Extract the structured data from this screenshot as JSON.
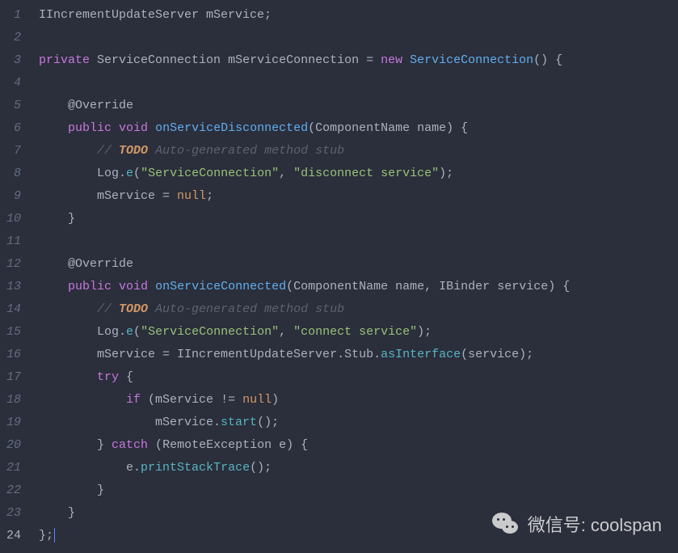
{
  "gutter": {
    "lines": [
      "1",
      "2",
      "3",
      "4",
      "5",
      "6",
      "7",
      "8",
      "9",
      "10",
      "11",
      "12",
      "13",
      "14",
      "15",
      "16",
      "17",
      "18",
      "19",
      "20",
      "21",
      "22",
      "23",
      "24"
    ],
    "active_line": "24"
  },
  "code": {
    "l1": {
      "type1": "IIncrementUpdateServer",
      "var": " mService;"
    },
    "l3": {
      "kw": "private",
      "sp1": " ",
      "type": "ServiceConnection",
      "sp2": " mServiceConnection = ",
      "kw2": "new",
      "sp3": " ",
      "ctor": "ServiceConnection",
      "tail": "() {"
    },
    "l5": {
      "anno": "@Override"
    },
    "l6": {
      "kw": "public",
      "sp": " ",
      "kw2": "void",
      "sp2": " ",
      "method": "onServiceDisconnected",
      "open": "(",
      "ptype": "ComponentName",
      "pname": " name",
      "close": ") {"
    },
    "l7": {
      "c1": "// ",
      "todo": "TODO",
      "c2": " Auto-generated method stub"
    },
    "l8": {
      "obj": "Log.",
      "m": "e",
      "open": "(",
      "s1": "\"ServiceConnection\"",
      "comma": ", ",
      "s2": "\"disconnect service\"",
      "close": ");"
    },
    "l9": {
      "lhs": "mService = ",
      "nul": "null",
      "semi": ";"
    },
    "l10": {
      "brace": "}"
    },
    "l12": {
      "anno": "@Override"
    },
    "l13": {
      "kw": "public",
      "sp": " ",
      "kw2": "void",
      "sp2": " ",
      "method": "onServiceConnected",
      "open": "(",
      "ptype": "ComponentName",
      "pname": " name, ",
      "ptype2": "IBinder",
      "pname2": " service",
      "close": ") {"
    },
    "l14": {
      "c1": "// ",
      "todo": "TODO",
      "c2": " Auto-generated method stub"
    },
    "l15": {
      "obj": "Log.",
      "m": "e",
      "open": "(",
      "s1": "\"ServiceConnection\"",
      "comma": ", ",
      "s2": "\"connect service\"",
      "close": ");"
    },
    "l16": {
      "txt": "mService = IIncrementUpdateServer.Stub.",
      "m": "asInterface",
      "tail": "(service);"
    },
    "l17": {
      "kw": "try",
      "brace": " {"
    },
    "l18": {
      "kw": "if",
      "open": " (mService != ",
      "nul": "null",
      "close": ")"
    },
    "l19": {
      "txt": "mService.",
      "m": "start",
      "tail": "();"
    },
    "l20": {
      "close": "} ",
      "kw": "catch",
      "open": " (",
      "type": "RemoteException",
      "var": " e",
      "close2": ") {"
    },
    "l21": {
      "txt": "e.",
      "m": "printStackTrace",
      "tail": "();"
    },
    "l22": {
      "brace": "}"
    },
    "l23": {
      "brace": "}"
    },
    "l24": {
      "brace": "};"
    }
  },
  "watermark": {
    "label": "微信号: coolspan"
  }
}
